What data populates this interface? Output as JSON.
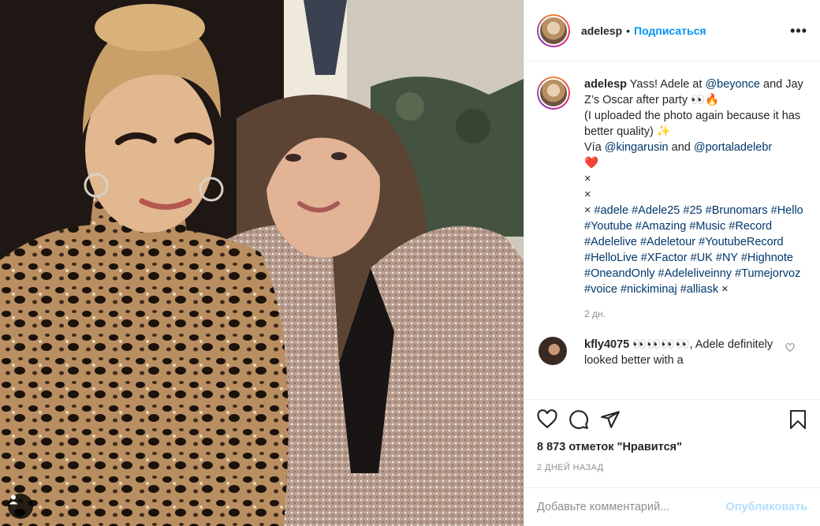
{
  "post": {
    "image_alt": "Photo: two women posing together",
    "username": "adelesp",
    "separator": "•",
    "follow_label": "Подписаться",
    "more_label": "•••"
  },
  "caption": {
    "username": "adelesp",
    "line1": "Yass! Adele at",
    "mention1": "@beyonce",
    "line1b": "and Jay Z’s Oscar after party",
    "emoji1": "👀🔥",
    "line2": "(I uploaded the photo again because it has better quality)",
    "emoji2": "✨",
    "via": "Vía",
    "mention2": "@kingarusin",
    "and": "and",
    "mention3": "@portaladelebr",
    "heart": "❤️",
    "x1": "×",
    "x2": "×",
    "x3": "×",
    "hashtags": [
      "#adele",
      "#Adele25",
      "#25",
      "#Brunomars",
      "#Hello",
      "#Youtube",
      "#Amazing",
      "#Music",
      "#Record",
      "#Adelelive",
      "#Adeletour",
      "#YoutubeRecord",
      "#HelloLive",
      "#XFactor",
      "#UK",
      "#NY",
      "#Highnote",
      "#OneandOnly",
      "#Adeleliveinny",
      "#Tumejorvoz",
      "#voice",
      "#nickiminaj",
      "#alliask"
    ],
    "x4": "×",
    "time": "2 дн."
  },
  "comment": {
    "username": "kfly4075",
    "emoji": "👀👀👀👀",
    "text": ", Adele definitely looked better with a"
  },
  "actions": {
    "likes": "8 873 отметок \"Нравится\"",
    "date": "2 ДНЕЙ НАЗАД"
  },
  "add_comment": {
    "placeholder": "Добавьте комментарий...",
    "publish_label": "Опубликовать"
  },
  "colors": {
    "accent": "#0095f6",
    "link": "#00376b",
    "publish_disabled": "#b2dffc",
    "muted": "#8e8e8e"
  }
}
